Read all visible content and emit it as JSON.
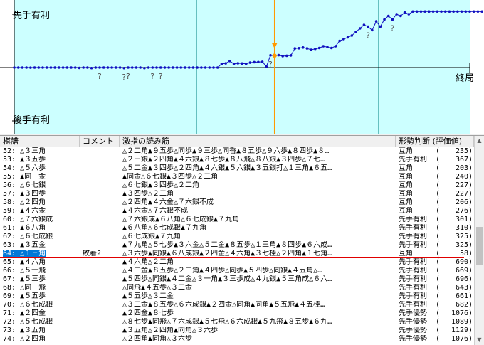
{
  "graph": {
    "sente_label": "先手有利",
    "gote_label": "後手有利",
    "end_label": "終局",
    "current_move": 64,
    "total_moves": 113,
    "value_scale": 3000,
    "evals": [
      0,
      0,
      0,
      0,
      -5,
      0,
      0,
      0,
      0,
      0,
      0,
      0,
      0,
      0,
      0,
      0,
      -20,
      0,
      0,
      -30,
      0,
      0,
      0,
      0,
      0,
      0,
      0,
      -30,
      0,
      0,
      0,
      0,
      -30,
      0,
      0,
      0,
      0,
      0,
      0,
      0,
      0,
      0,
      0,
      0,
      0,
      0,
      0,
      0,
      0,
      0,
      0,
      203,
      235,
      367,
      203,
      240,
      227,
      206,
      276,
      301,
      310,
      325,
      58,
      690,
      669,
      696,
      643,
      661,
      682,
      1076,
      1089,
      1129,
      1076,
      1000,
      1050,
      1100,
      1200,
      1150,
      1100,
      1200,
      1500,
      1600,
      1700,
      1800,
      2000,
      2200,
      2400,
      2300,
      2100,
      2600,
      2300,
      2700,
      2900,
      2700,
      3000,
      2900,
      3100,
      3000,
      3300,
      3200,
      3400,
      3500,
      3600,
      3500,
      3600,
      3700,
      3800,
      3900,
      4100,
      4050,
      4100,
      4100,
      4100,
      4100,
      4100,
      4100
    ],
    "question_marks": [
      21,
      27,
      28,
      34,
      36,
      63,
      87,
      93
    ]
  },
  "table": {
    "headers": {
      "move": "棋譜",
      "comment": "コメント",
      "reading": "激指の読み筋",
      "judge": "形勢判断 (評価値)"
    },
    "rows": [
      {
        "move": "52: △３三角",
        "comment": "",
        "reading": "△２二角▲９五歩△同歩▲９三歩△同香▲８五歩△９六歩▲８四歩▲８…",
        "judge": "互角",
        "value": "235"
      },
      {
        "move": "53: ▲３五歩",
        "comment": "",
        "reading": "△２三銀▲２四角▲４六銀▲８七歩▲８八飛△８八銀▲３四歩△７七…",
        "judge": "先手有利",
        "value": "367"
      },
      {
        "move": "54: △５六歩",
        "comment": "",
        "reading": "△５二金▲３四歩△２四角▲４六銀▲５六銀▲３五銀打△１三角▲６五…",
        "judge": "互角",
        "value": "203"
      },
      {
        "move": "55: ▲同　金",
        "comment": "",
        "reading": "▲同金△６七銀▲３四歩△２二角",
        "judge": "互角",
        "value": "240"
      },
      {
        "move": "56: △６七銀",
        "comment": "",
        "reading": "△６七銀▲３四歩△２二角",
        "judge": "互角",
        "value": "227"
      },
      {
        "move": "57: ▲３四歩",
        "comment": "",
        "reading": "▲３四歩△２二角",
        "judge": "互角",
        "value": "227"
      },
      {
        "move": "58: △２四角",
        "comment": "",
        "reading": "△２四角▲４六金△７六銀不成",
        "judge": "互角",
        "value": "206"
      },
      {
        "move": "59: ▲４六金",
        "comment": "",
        "reading": "▲４六金△７六銀不成",
        "judge": "互角",
        "value": "276"
      },
      {
        "move": "60: △７六銀成",
        "comment": "",
        "reading": "△７六銀成▲６八角△６七成銀▲７九角",
        "judge": "先手有利",
        "value": "301"
      },
      {
        "move": "61: ▲６八角",
        "comment": "",
        "reading": "▲６八角△６七成銀▲７九角",
        "judge": "先手有利",
        "value": "310"
      },
      {
        "move": "62: △６七成銀",
        "comment": "",
        "reading": "△６七成銀▲７九角",
        "judge": "先手有利",
        "value": "325"
      },
      {
        "move": "63: ▲３五金",
        "comment": "",
        "reading": "▲７九角△５七歩▲３六金△５二金▲８五歩△１三角▲８四歩▲６六成…",
        "judge": "先手有利",
        "value": "325"
      },
      {
        "move": "64: △１三角",
        "comment": "敗着?",
        "reading": "△３六歩▲同銀▲６八成銀▲２四金△４六角▲３七桂△２四角▲１七角…",
        "judge": "互角",
        "value": "58"
      },
      {
        "move": "65: ▲４六角",
        "comment": "",
        "reading": "▲４六角△２二角",
        "judge": "先手有利",
        "value": "690"
      },
      {
        "move": "66: △５一飛",
        "comment": "",
        "reading": "△４二金▲８五歩△２二角▲４四歩△同歩▲５四歩△同銀▲４五角△…",
        "judge": "先手有利",
        "value": "669"
      },
      {
        "move": "67: ▲５三歩",
        "comment": "",
        "reading": "▲５四歩△同銀▲４二金△３一角▲３三歩成△４九銀▲５三角成△６六…",
        "judge": "先手有利",
        "value": "696"
      },
      {
        "move": "68: △同　飛",
        "comment": "",
        "reading": "△同飛▲４五歩△３二金",
        "judge": "先手有利",
        "value": "643"
      },
      {
        "move": "69: ▲５五歩",
        "comment": "",
        "reading": "▲５五歩△３二金",
        "judge": "先手有利",
        "value": "661"
      },
      {
        "move": "70: △６七成銀",
        "comment": "",
        "reading": "△３二金▲８五歩△６六成銀▲２四金△同角▲同角▲５五飛▲４五桂…",
        "judge": "先手有利",
        "value": "682"
      },
      {
        "move": "71: ▲２四金",
        "comment": "",
        "reading": "▲２四金▲８七歩",
        "judge": "先手優勢",
        "value": "1076"
      },
      {
        "move": "72: △５七成銀",
        "comment": "",
        "reading": "△８七歩▲同飛△７六成銀▲５七飛△６六成銀▲５九飛▲８五歩▲６九…",
        "judge": "先手優勢",
        "value": "1089"
      },
      {
        "move": "73: ▲３五角",
        "comment": "",
        "reading": "▲３五角△２四角▲同角△３六歩",
        "judge": "先手優勢",
        "value": "1129"
      },
      {
        "move": "74: △２四角",
        "comment": "",
        "reading": "△２四角▲同角△３六歩",
        "judge": "先手優勢",
        "value": "1076"
      }
    ],
    "selected_index": 12
  },
  "colors": {
    "graph_bg": "#ccffff",
    "dots": "#1010c0",
    "cursor": "#ff9900",
    "grid": "#008080",
    "selected": "#0078d7",
    "redline": "#e00000"
  }
}
